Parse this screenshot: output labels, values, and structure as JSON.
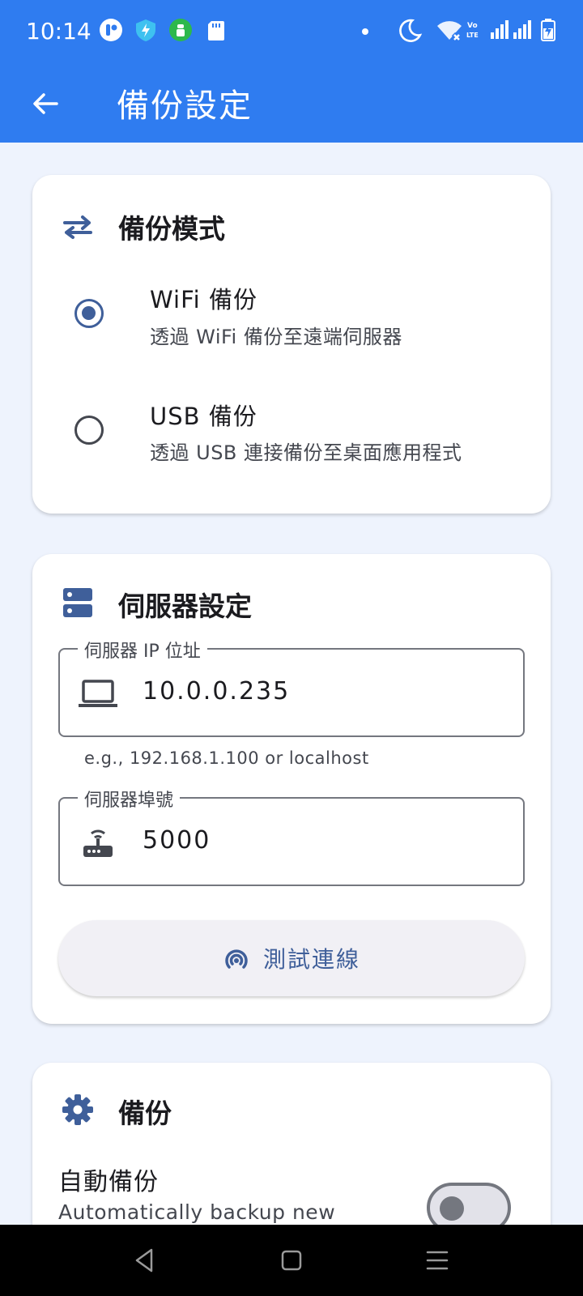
{
  "status_bar": {
    "time": "10:14",
    "icons": [
      "app-icon-t",
      "shield-bolt-icon",
      "android-icon",
      "sd-card-icon",
      "dot-icon",
      "moon-icon",
      "wifi-off-icon",
      "volte-icon",
      "signal-icon",
      "signal-icon",
      "battery-charging-icon"
    ]
  },
  "app_bar": {
    "title": "備份設定",
    "back_icon": "arrow-left-icon"
  },
  "backup_mode": {
    "title": "備份模式",
    "icon": "swap-horiz-icon",
    "options": [
      {
        "title": "WiFi 備份",
        "subtitle": "透過 WiFi 備份至遠端伺服器",
        "selected": true
      },
      {
        "title": "USB 備份",
        "subtitle": "透過 USB 連接備份至桌面應用程式",
        "selected": false
      }
    ]
  },
  "server_settings": {
    "title": "伺服器設定",
    "icon": "dns-icon",
    "ip_field": {
      "label": "伺服器 IP 位址",
      "value": "10.0.0.235",
      "helper": "e.g., 192.168.1.100 or localhost",
      "icon": "laptop-icon"
    },
    "port_field": {
      "label": "伺服器埠號",
      "value": "5000",
      "icon": "router-icon"
    },
    "test_button": {
      "label": "測試連線",
      "icon": "broadcast-icon"
    }
  },
  "backup": {
    "title": "備份",
    "icon": "gear-icon",
    "auto_backup": {
      "title": "自動備份",
      "subtitle": "Automatically backup new",
      "enabled": false
    }
  },
  "colors": {
    "app_bar": "#2f7cf0",
    "accent": "#3f5f9a",
    "background": "#eef3fd"
  }
}
